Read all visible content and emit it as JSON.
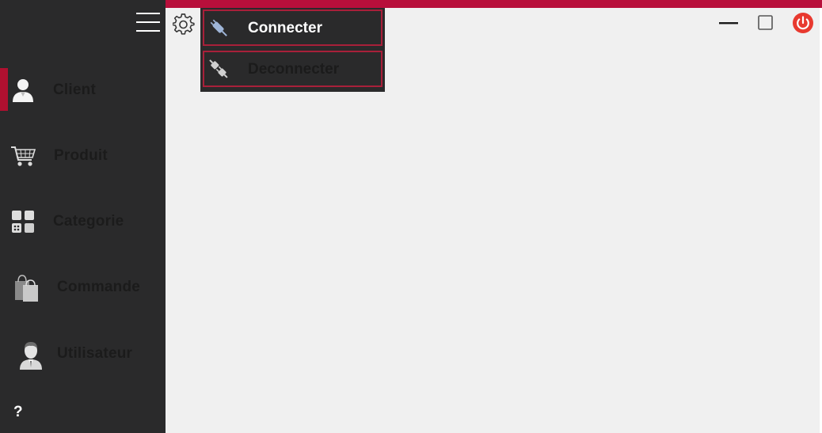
{
  "sidebar": {
    "items": [
      {
        "label": "Client",
        "icon": "user-icon",
        "active": true
      },
      {
        "label": "Produit",
        "icon": "shopping-cart-icon"
      },
      {
        "label": "Categorie",
        "icon": "category-grid-icon"
      },
      {
        "label": "Commande",
        "icon": "shopping-bags-icon"
      },
      {
        "label": "Utilisateur",
        "icon": "user-avatar-icon"
      }
    ],
    "help_label": "?"
  },
  "settings_menu": {
    "items": [
      {
        "label": "Connecter",
        "icon": "plug-connect-icon",
        "color": "#ffffff"
      },
      {
        "label": "Deconnecter",
        "icon": "plug-disconnect-icon",
        "color": "#1b1b1b"
      }
    ]
  },
  "window_controls": {
    "minimize": "minimize-icon",
    "maximize": "maximize-icon",
    "close": "power-icon"
  },
  "colors": {
    "accent": "#b80f3b",
    "sidebar_bg": "#2a2a2b",
    "content_bg": "#f0f0f0",
    "close_red": "#e8392f"
  }
}
